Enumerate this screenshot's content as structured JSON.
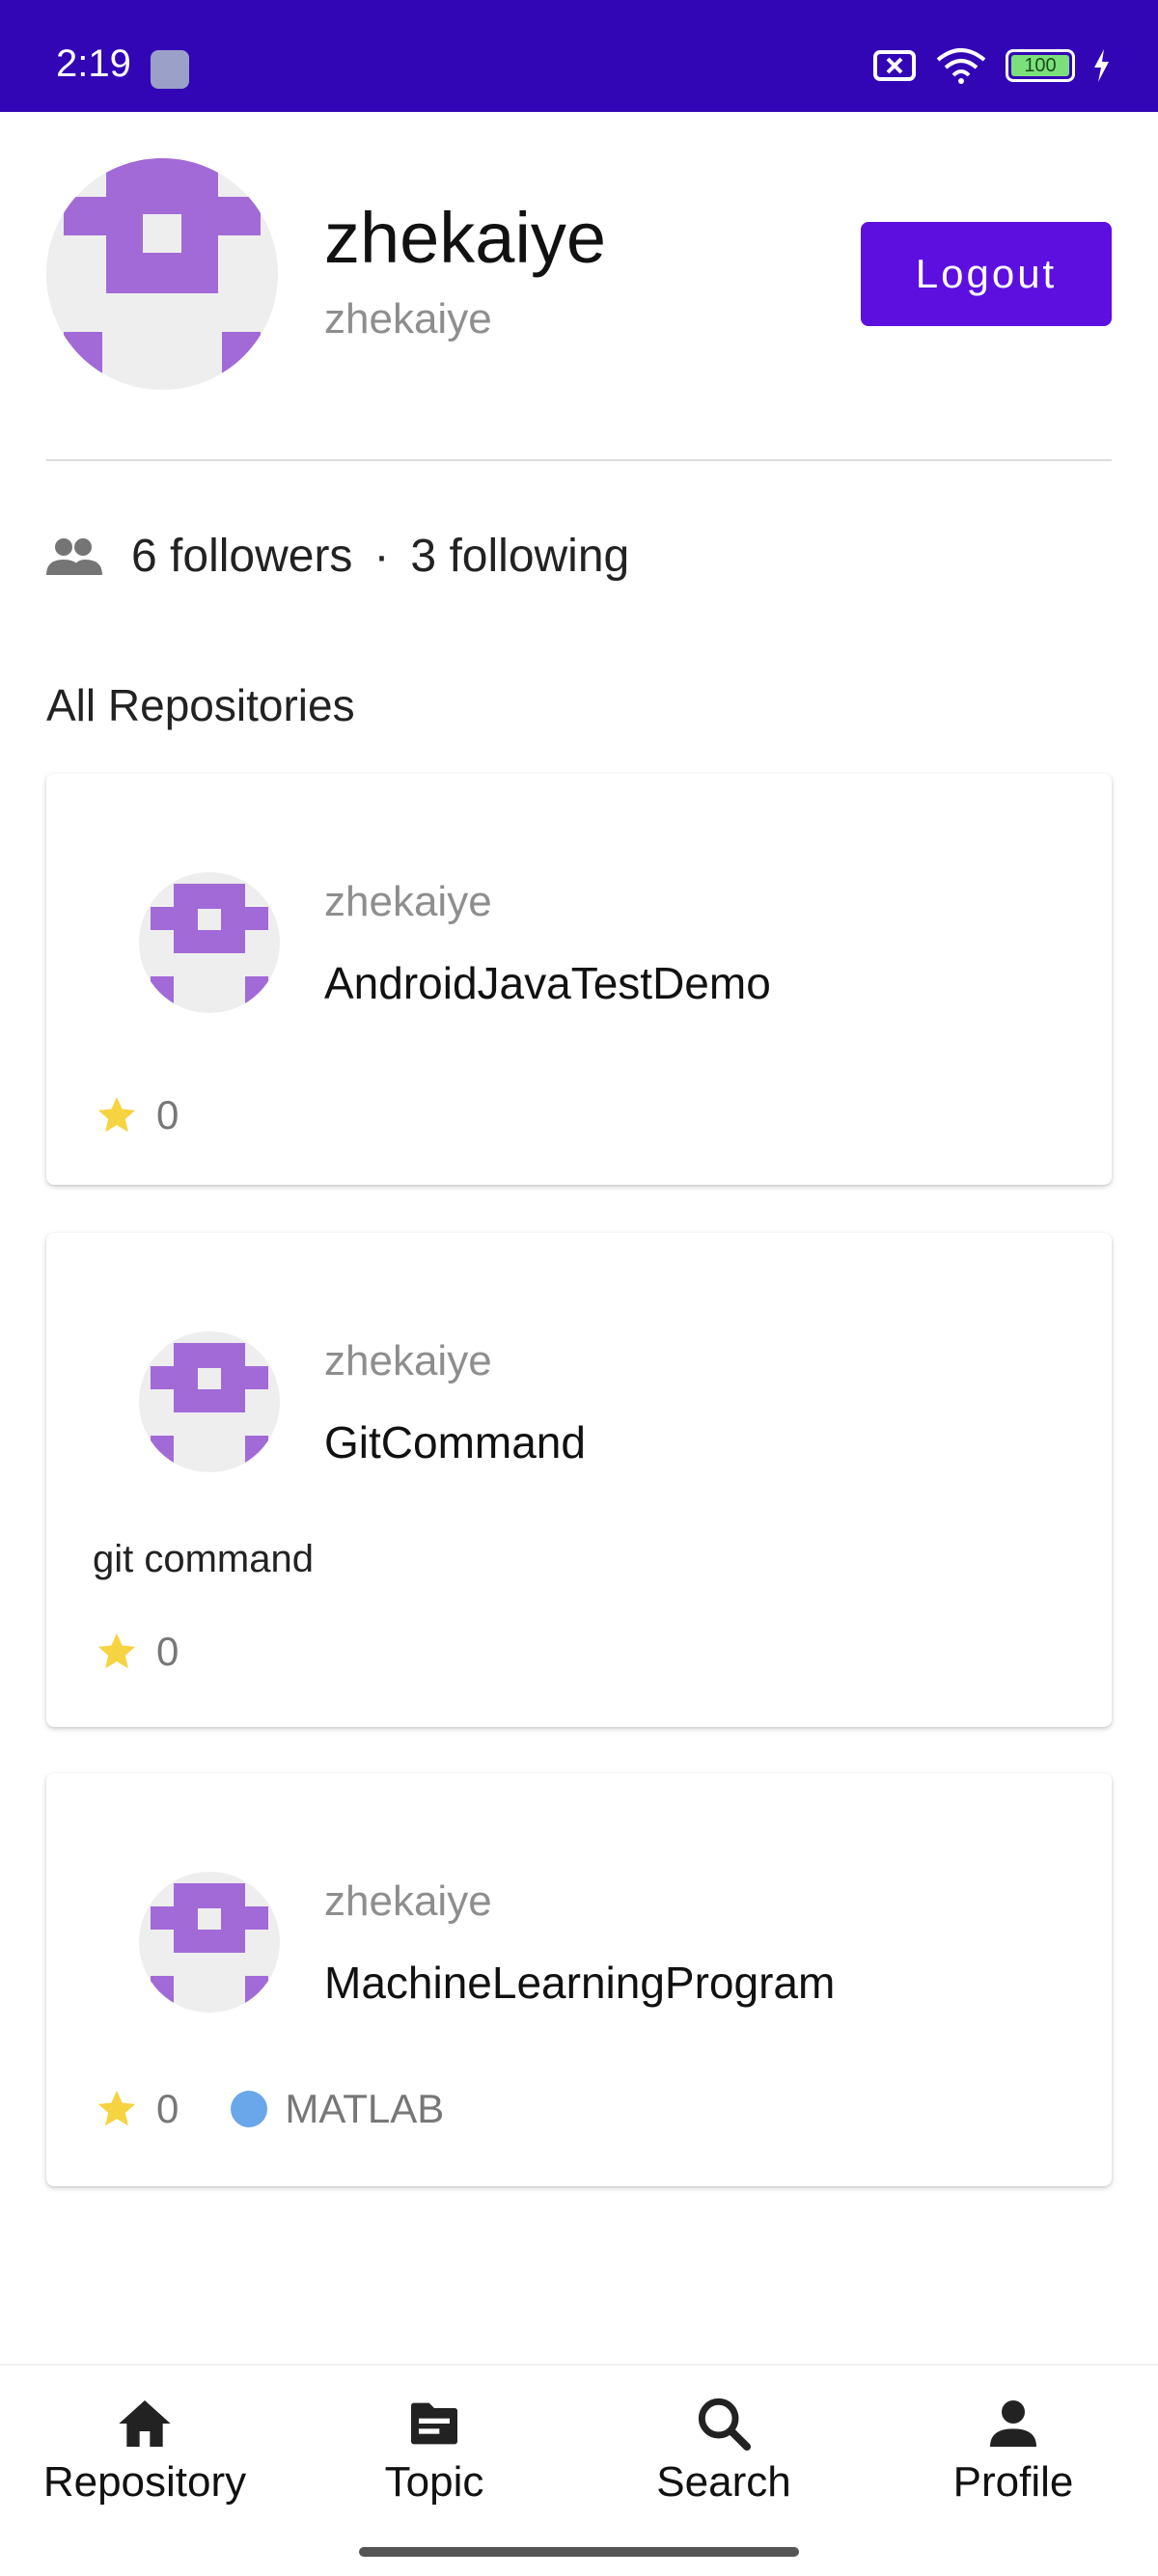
{
  "status_bar": {
    "time": "2:19",
    "battery": "100"
  },
  "profile": {
    "name": "zhekaiye",
    "login": "zhekaiye",
    "logout_label": "Logout"
  },
  "social": {
    "followers": "6 followers",
    "separator": "·",
    "following": "3 following"
  },
  "section_title": "All Repositories",
  "repos": [
    {
      "owner": "zhekaiye",
      "name": "AndroidJavaTestDemo",
      "description": "",
      "stars": "0",
      "language": ""
    },
    {
      "owner": "zhekaiye",
      "name": "GitCommand",
      "description": "git command",
      "stars": "0",
      "language": ""
    },
    {
      "owner": "zhekaiye",
      "name": "MachineLearningProgram",
      "description": "",
      "stars": "0",
      "language": "MATLAB",
      "language_color": "#6aa6ea"
    }
  ],
  "nav": {
    "items": [
      {
        "label": "Repository",
        "icon": "home-icon"
      },
      {
        "label": "Topic",
        "icon": "topic-icon"
      },
      {
        "label": "Search",
        "icon": "search-icon"
      },
      {
        "label": "Profile",
        "icon": "person-icon"
      }
    ]
  },
  "colors": {
    "status_bar": "#3205b5",
    "accent": "#5d0fe0",
    "avatar_purple": "#a26ad7",
    "star": "#f6d340"
  }
}
